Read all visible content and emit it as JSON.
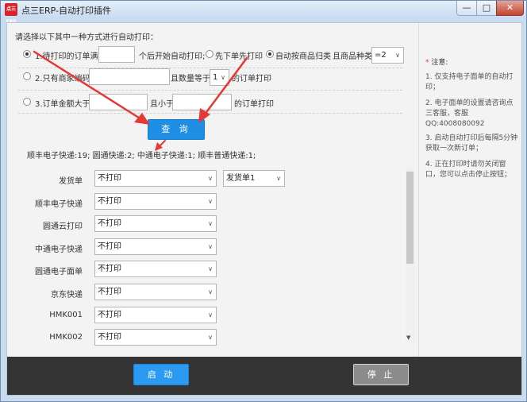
{
  "window": {
    "title": "点三ERP-自动打印插件",
    "icon_label": "点三ERP",
    "minimize": "—",
    "maximize": "□",
    "close": "✕"
  },
  "main": {
    "instruction": "请选择以下其中一种方式进行自动打印：",
    "option1": {
      "prefix": "1.待打印的订单满",
      "value": "",
      "suffix": "个后开始自动打印;",
      "selected": true
    },
    "radio_first_pay": {
      "label": "先下单先打印",
      "selected": false
    },
    "radio_by_category": {
      "label": "自动按商品归类",
      "selected": true
    },
    "category_label": "且商品种类",
    "category_select": "=2",
    "option2": {
      "prefix": "2.只有商家编码",
      "code_value": "",
      "mid": "且数量等于",
      "qty_select": "1",
      "suffix": "的订单打印",
      "selected": false
    },
    "option3": {
      "prefix": "3.订单金额大于",
      "min_value": "",
      "mid": "且小于",
      "max_value": "",
      "suffix": "的订单打印",
      "selected": false
    },
    "query_button": "查 询",
    "summary": "顺丰电子快递:19; 圆通快递:2; 中通电子快递:1; 顺丰普通快递:1;",
    "rows": [
      {
        "label": "发货单",
        "value": "不打印",
        "extra": "发货单1"
      },
      {
        "label": "顺丰电子快递",
        "value": "不打印"
      },
      {
        "label": "圆通云打印",
        "value": "不打印"
      },
      {
        "label": "中通电子快递",
        "value": "不打印"
      },
      {
        "label": "圆通电子面单",
        "value": "不打印"
      },
      {
        "label": "京东快递",
        "value": "不打印"
      },
      {
        "label": "HMK001",
        "value": "不打印"
      },
      {
        "label": "HMK002",
        "value": "不打印"
      }
    ]
  },
  "side": {
    "heading_star": "*",
    "heading": "注意:",
    "notes": [
      "1. 仅支持电子面单的自动打印；",
      "2. 电子面单的设置请咨询点三客服，客服QQ:4008080092",
      "3. 启动自动打印后每隔5分钟获取一次新订单；",
      "4. 正在打印时请勿关闭窗口，您可以点击停止按钮；"
    ]
  },
  "footer": {
    "start_button": "启 动",
    "stop_button": "停 止"
  },
  "colors": {
    "accent": "#1f8fe6",
    "arrow": "#e53935",
    "footer_bg": "#343434"
  }
}
